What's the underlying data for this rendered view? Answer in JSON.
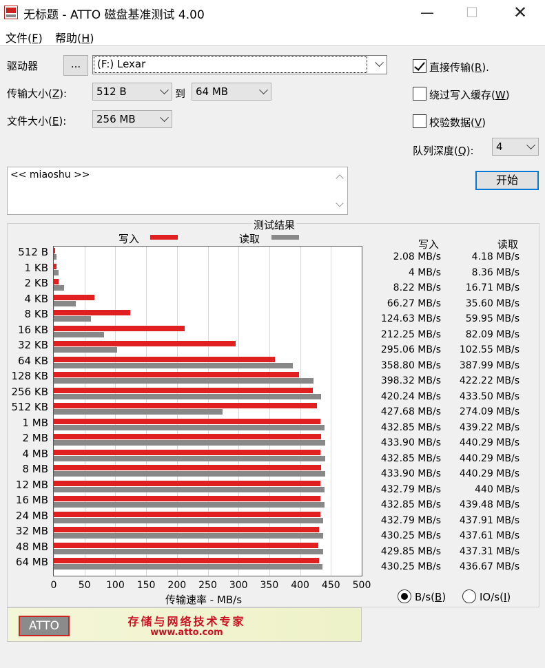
{
  "window": {
    "title": "无标题 - ATTO 磁盘基准测试 4.00",
    "minimize": "—",
    "maximize": "☐",
    "close": "✕"
  },
  "menu": [
    {
      "label": "文件",
      "key": "F"
    },
    {
      "label": "帮助",
      "key": "H"
    }
  ],
  "form": {
    "drive_label": "驱动器",
    "browse_label": "...",
    "drive_value": "(F:) Lexar",
    "transfer_label": "传输大小",
    "transfer_key": "Z",
    "transfer_from": "512 B",
    "to_label": "到",
    "transfer_to": "64 MB",
    "file_size_label": "文件大小",
    "file_size_key": "E",
    "file_size_value": "256 MB",
    "direct_io_label": "直接传输",
    "direct_io_key": "R",
    "direct_io_checked": true,
    "bypass_cache_label": "绕过写入缓存",
    "bypass_cache_key": "W",
    "bypass_cache_checked": false,
    "verify_label": "校验数据",
    "verify_key": "V",
    "verify_checked": false,
    "queue_label": "队列深度",
    "queue_key": "Q",
    "queue_value": "4",
    "start_label": "开始",
    "description": "<< miaoshu >>"
  },
  "results": {
    "title": "测试结果",
    "write_label": "写入",
    "read_label": "读取",
    "col_write": "写入",
    "col_read": "读取",
    "write_color": "#e02020",
    "read_color": "#888888",
    "rows": [
      {
        "size": "512 B",
        "write": "2.08 MB/s",
        "read": "4.18 MB/s"
      },
      {
        "size": "1 KB",
        "write": "4 MB/s",
        "read": "8.36 MB/s"
      },
      {
        "size": "2 KB",
        "write": "8.22 MB/s",
        "read": "16.71 MB/s"
      },
      {
        "size": "4 KB",
        "write": "66.27 MB/s",
        "read": "35.60 MB/s"
      },
      {
        "size": "8 KB",
        "write": "124.63 MB/s",
        "read": "59.95 MB/s"
      },
      {
        "size": "16 KB",
        "write": "212.25 MB/s",
        "read": "82.09 MB/s"
      },
      {
        "size": "32 KB",
        "write": "295.06 MB/s",
        "read": "102.55 MB/s"
      },
      {
        "size": "64 KB",
        "write": "358.80 MB/s",
        "read": "387.99 MB/s"
      },
      {
        "size": "128 KB",
        "write": "398.32 MB/s",
        "read": "422.22 MB/s"
      },
      {
        "size": "256 KB",
        "write": "420.24 MB/s",
        "read": "433.50 MB/s"
      },
      {
        "size": "512 KB",
        "write": "427.68 MB/s",
        "read": "274.09 MB/s"
      },
      {
        "size": "1 MB",
        "write": "432.85 MB/s",
        "read": "439.22 MB/s"
      },
      {
        "size": "2 MB",
        "write": "433.90 MB/s",
        "read": "440.29 MB/s"
      },
      {
        "size": "4 MB",
        "write": "432.85 MB/s",
        "read": "440.29 MB/s"
      },
      {
        "size": "8 MB",
        "write": "433.90 MB/s",
        "read": "440.29 MB/s"
      },
      {
        "size": "12 MB",
        "write": "432.79 MB/s",
        "read": "440 MB/s"
      },
      {
        "size": "16 MB",
        "write": "432.85 MB/s",
        "read": "439.48 MB/s"
      },
      {
        "size": "24 MB",
        "write": "432.79 MB/s",
        "read": "437.91 MB/s"
      },
      {
        "size": "32 MB",
        "write": "430.25 MB/s",
        "read": "437.61 MB/s"
      },
      {
        "size": "48 MB",
        "write": "429.85 MB/s",
        "read": "437.31 MB/s"
      },
      {
        "size": "64 MB",
        "write": "430.25 MB/s",
        "read": "436.67 MB/s"
      }
    ],
    "unit_bs_label": "B/s",
    "unit_bs_key": "B",
    "unit_ios_label": "IO/s",
    "unit_ios_key": "I",
    "unit_selected": "B/s"
  },
  "chart_data": {
    "type": "bar",
    "orientation": "horizontal",
    "xlabel": "传输速率 - MB/s",
    "xlim": [
      0,
      500
    ],
    "xticks": [
      "0",
      "50",
      "100",
      "150",
      "200",
      "250",
      "300",
      "350",
      "400",
      "450",
      "500"
    ],
    "grid": true,
    "categories": [
      "512 B",
      "1 KB",
      "2 KB",
      "4 KB",
      "8 KB",
      "16 KB",
      "32 KB",
      "64 KB",
      "128 KB",
      "256 KB",
      "512 KB",
      "1 MB",
      "2 MB",
      "4 MB",
      "8 MB",
      "12 MB",
      "16 MB",
      "24 MB",
      "32 MB",
      "48 MB",
      "64 MB"
    ],
    "series": [
      {
        "name": "写入",
        "values": [
          2.08,
          4,
          8.22,
          66.27,
          124.63,
          212.25,
          295.06,
          358.8,
          398.32,
          420.24,
          427.68,
          432.85,
          433.9,
          432.85,
          433.9,
          432.79,
          432.85,
          432.79,
          430.25,
          429.85,
          430.25
        ]
      },
      {
        "name": "读取",
        "values": [
          4.18,
          8.36,
          16.71,
          35.6,
          59.95,
          82.09,
          102.55,
          387.99,
          422.22,
          433.5,
          274.09,
          439.22,
          440.29,
          440.29,
          440.29,
          440,
          439.48,
          437.91,
          437.61,
          437.31,
          436.67
        ]
      }
    ]
  },
  "banner": {
    "logo": "ATTO",
    "tagline": "存储与网络技术专家",
    "url": "www.atto.com"
  }
}
